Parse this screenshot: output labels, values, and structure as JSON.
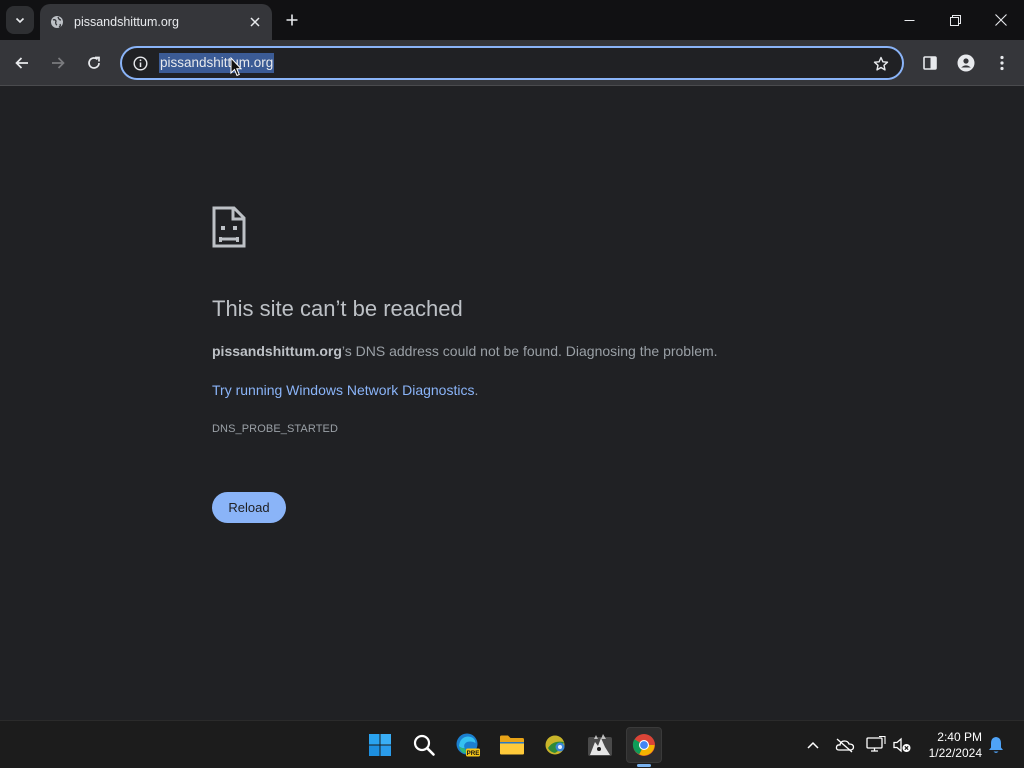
{
  "browser": {
    "tab": {
      "title": "pissandshittum.org",
      "favicon": "globe-icon"
    },
    "omnibox": {
      "url": "pissandshittum.org"
    }
  },
  "error": {
    "title": "This site can’t be reached",
    "domain": "pissandshittum.org",
    "description_suffix": "’s DNS address could not be found. Diagnosing the problem.",
    "link_text": "Try running Windows Network Diagnostics",
    "link_suffix": ".",
    "code": "DNS_PROBE_STARTED",
    "reload_label": "Reload"
  },
  "taskbar": {
    "apps": [
      "start-icon",
      "search-icon",
      "edge-beta-icon",
      "file-explorer-icon",
      "app-icon",
      "app-icon",
      "chrome-icon"
    ],
    "edge_badge": "PRE",
    "clock": {
      "time": "2:40 PM",
      "date": "1/22/2024"
    }
  },
  "colors": {
    "background": "#202124",
    "accent": "#8ab4f8",
    "title_text": "#bdc1c6",
    "body_text": "#9aa0a6"
  }
}
